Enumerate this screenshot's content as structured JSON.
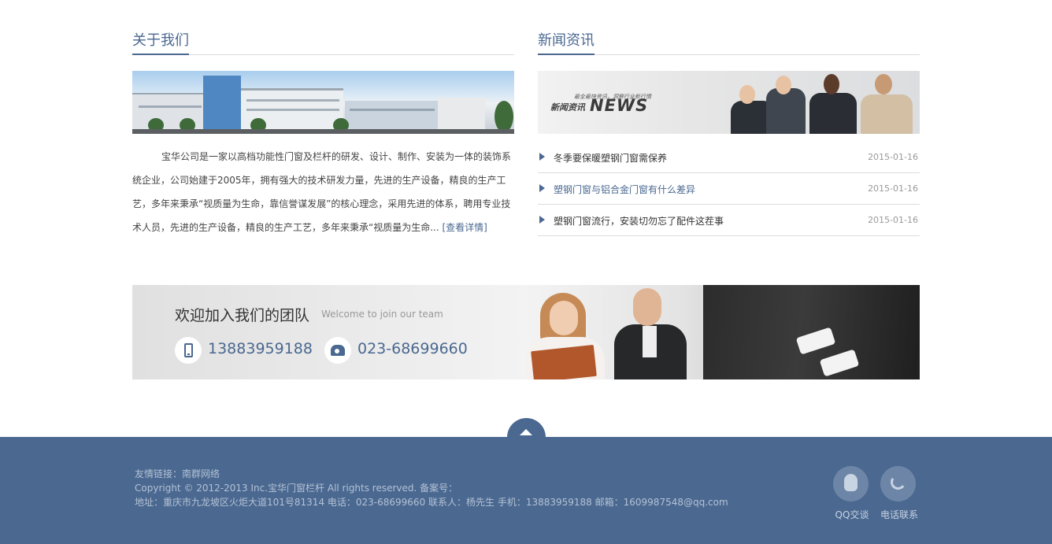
{
  "about": {
    "title": "关于我们",
    "paragraph": "宝华公司是一家以高档功能性门窗及栏杆的研发、设计、制作、安装为一体的装饰系统企业，公司始建于2005年，拥有强大的技术研发力量，先进的生产设备，精良的生产工艺，多年来秉承“视质量为生命，靠信誉谋发展”的核心理念，采用先进的体系，聘用专业技术人员，先进的生产设备，精良的生产工艺，多年来秉承“视质量为生命...",
    "more_label": "[查看详情]"
  },
  "news": {
    "title": "新闻资讯",
    "banner": {
      "slogan": "最全最快资讯，洞察行业新行情",
      "label": "新闻资讯",
      "label_en": "NEWS"
    },
    "items": [
      {
        "title": "冬季要保暖塑钢门窗需保养",
        "date": "2015-01-16",
        "active": false
      },
      {
        "title": "塑钢门窗与铝合金门窗有什么差异",
        "date": "2015-01-16",
        "active": true
      },
      {
        "title": "塑钢门窗流行，安装切勿忘了配件这茬事",
        "date": "2015-01-16",
        "active": false
      }
    ]
  },
  "team": {
    "title": "欢迎加入我们的团队",
    "subtitle": "Welcome to join our team",
    "mobile": "13883959188",
    "phone": "023-68699660"
  },
  "footer": {
    "links": "友情链接：南群网络",
    "copyright": "Copyright © 2012-2013 Inc.宝华门窗栏杆 All rights reserved. 备案号：",
    "address": "地址：重庆市九龙坡区火炬大道101号81314 电话：023-68699660  联系人：杨先生  手机：13883959188  邮箱：1609987548@qq.com",
    "qq_label": "QQ交谈",
    "phone_label": "电话联系"
  },
  "colors": {
    "accent": "#4a6890",
    "footer_bg": "#4a6890"
  }
}
